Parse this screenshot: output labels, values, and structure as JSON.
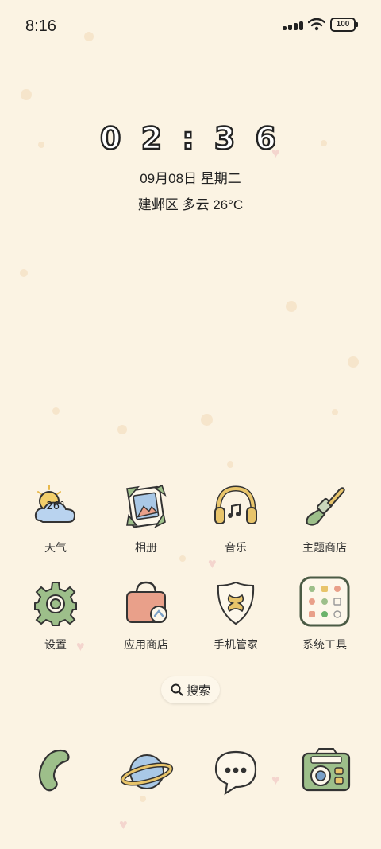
{
  "status_bar": {
    "time": "8:16",
    "battery": "100",
    "icons": [
      "signal-dots-icon",
      "wifi-icon",
      "battery-icon"
    ]
  },
  "clock_widget": {
    "time": "0 2 : 3 6",
    "date": "09月08日 星期二",
    "weather": "建邺区 多云 26°C"
  },
  "apps": [
    {
      "label": "天气",
      "icon": "weather-icon",
      "temp": "26°"
    },
    {
      "label": "相册",
      "icon": "gallery-icon"
    },
    {
      "label": "音乐",
      "icon": "headphones-icon"
    },
    {
      "label": "主题商店",
      "icon": "paintbrush-icon"
    },
    {
      "label": "设置",
      "icon": "gear-icon"
    },
    {
      "label": "应用商店",
      "icon": "shopping-bag-icon"
    },
    {
      "label": "手机管家",
      "icon": "shield-icon"
    },
    {
      "label": "系统工具",
      "icon": "folder-icon"
    }
  ],
  "search": {
    "label": "搜索"
  },
  "dock": [
    {
      "icon": "phone-icon"
    },
    {
      "icon": "planet-browser-icon"
    },
    {
      "icon": "chat-bubble-icon"
    },
    {
      "icon": "camera-icon"
    }
  ],
  "colors": {
    "background": "#fbf3e3",
    "sage_green": "#9dbf8a",
    "peach": "#e9a08a",
    "cream": "#fdf7ea",
    "accent_yellow": "#e8c46a",
    "sky_blue": "#a9c8e6"
  }
}
